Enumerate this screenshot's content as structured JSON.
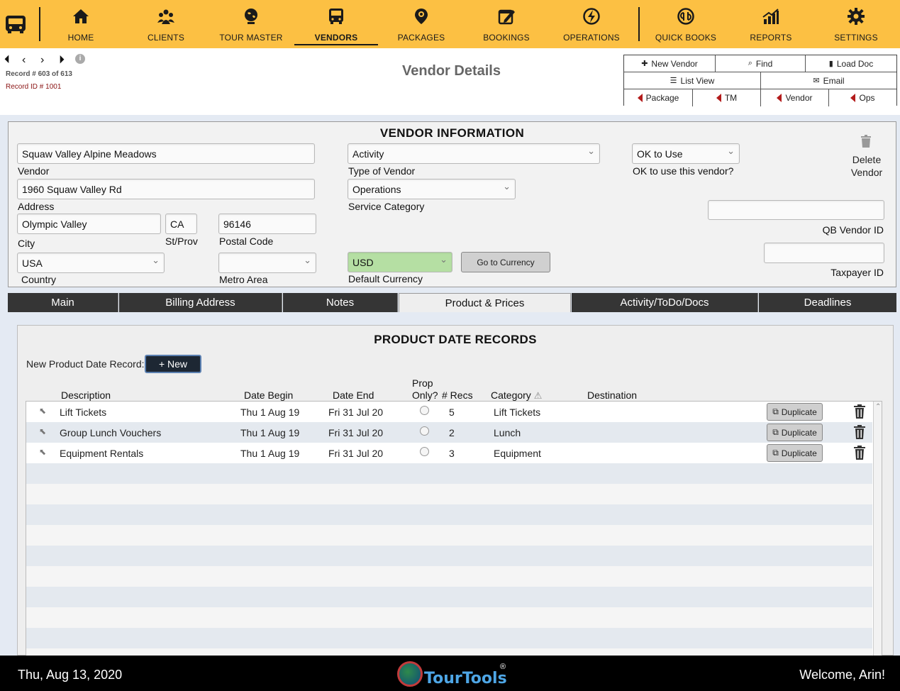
{
  "nav": {
    "items": [
      {
        "label": "HOME",
        "icon": "home-icon"
      },
      {
        "label": "CLIENTS",
        "icon": "clients-icon"
      },
      {
        "label": "TOUR MASTER",
        "icon": "globe-icon"
      },
      {
        "label": "VENDORS",
        "icon": "bus-icon"
      },
      {
        "label": "PACKAGES",
        "icon": "location-pin-icon"
      },
      {
        "label": "BOOKINGS",
        "icon": "edit-calendar-icon"
      },
      {
        "label": "OPERATIONS",
        "icon": "bolt-icon"
      },
      {
        "label": "QUICK BOOKS",
        "icon": "quickbooks-icon"
      },
      {
        "label": "REPORTS",
        "icon": "chart-icon"
      },
      {
        "label": "SETTINGS",
        "icon": "gear-icon"
      }
    ],
    "active": "VENDORS",
    "accent": "#fcc043"
  },
  "record": {
    "position": "Record # 603 of 613",
    "id": "Record ID # 1001"
  },
  "page_title": "Vendor Details",
  "actions": {
    "new_vendor": "New Vendor",
    "find": "Find",
    "load_doc": "Load Doc",
    "list_view": "List View",
    "email": "Email",
    "package": "Package",
    "tm": "TM",
    "vendor": "Vendor",
    "ops": "Ops"
  },
  "vendor_info": {
    "title": "VENDOR INFORMATION",
    "vendor": {
      "value": "Squaw Valley Alpine Meadows",
      "label": "Vendor"
    },
    "address": {
      "value": "1960 Squaw Valley Rd",
      "label": "Address"
    },
    "city": {
      "value": "Olympic Valley",
      "label": "City"
    },
    "state": {
      "value": "CA",
      "label": "St/Prov"
    },
    "postal": {
      "value": "96146",
      "label": "Postal Code"
    },
    "country": {
      "value": "USA",
      "label": "Country"
    },
    "metro": {
      "value": "",
      "label": "Metro Area"
    },
    "type": {
      "value": "Activity",
      "label": "Type of Vendor"
    },
    "service": {
      "value": "Operations",
      "label": "Service Category"
    },
    "currency": {
      "value": "USD",
      "label": "Default Currency"
    },
    "go_currency": "Go to Currency",
    "ok": {
      "value": "OK to Use",
      "label": "OK to use this vendor?"
    },
    "delete_line1": "Delete",
    "delete_line2": "Vendor",
    "qb": {
      "value": "",
      "label": "QB Vendor ID"
    },
    "taxpayer": {
      "value": "",
      "label": "Taxpayer ID"
    }
  },
  "tabs": [
    {
      "label": "Main"
    },
    {
      "label": "Billing Address"
    },
    {
      "label": "Notes"
    },
    {
      "label": "Product & Prices"
    },
    {
      "label": "Activity/ToDo/Docs"
    },
    {
      "label": "Deadlines"
    }
  ],
  "active_tab": "Product & Prices",
  "product": {
    "title": "PRODUCT DATE RECORDS",
    "new_label": "New Product Date Record:",
    "new_button": "+ New",
    "columns": {
      "description": "Description",
      "date_begin": "Date Begin",
      "date_end": "Date End",
      "prop_only_1": "Prop",
      "prop_only_2": "Only?",
      "recs": "# Recs",
      "category": "Category",
      "destination": "Destination"
    },
    "rows": [
      {
        "description": "Lift Tickets",
        "date_begin": "Thu 1 Aug 19",
        "date_end": "Fri 31 Jul 20",
        "recs": "5",
        "category": "Lift Tickets",
        "destination": ""
      },
      {
        "description": "Group Lunch Vouchers",
        "date_begin": "Thu 1 Aug 19",
        "date_end": "Fri 31 Jul 20",
        "recs": "2",
        "category": "Lunch",
        "destination": ""
      },
      {
        "description": "Equipment Rentals",
        "date_begin": "Thu 1 Aug 19",
        "date_end": "Fri 31 Jul 20",
        "recs": "3",
        "category": "Equipment",
        "destination": ""
      }
    ],
    "duplicate_label": "Duplicate"
  },
  "footer": {
    "date": "Thu, Aug 13, 2020",
    "logo": "TourTools",
    "reg": "®",
    "welcome": "Welcome, Arin!"
  }
}
